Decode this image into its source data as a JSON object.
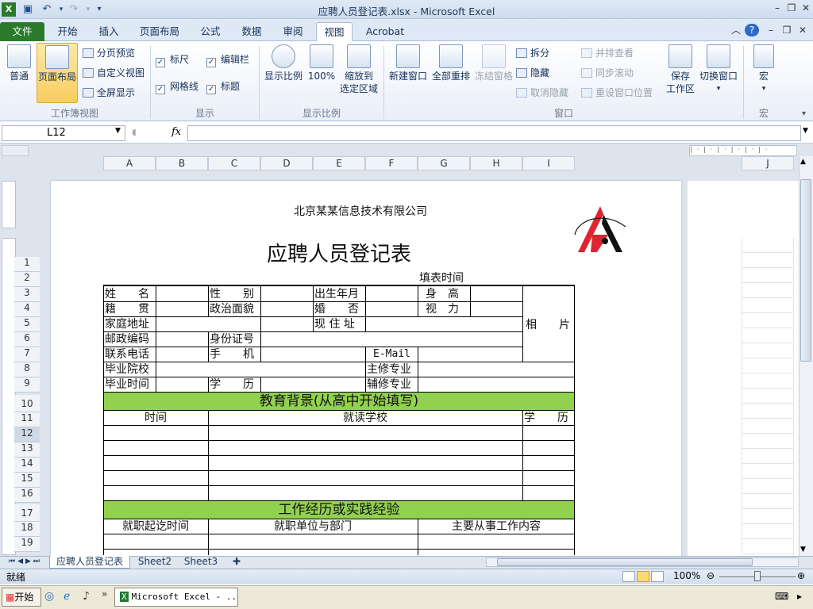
{
  "window": {
    "title": "应聘人员登记表.xlsx  -  Microsoft Excel"
  },
  "qat": {
    "save_icon": "save-icon",
    "undo_icon": "undo-icon",
    "redo_icon": "redo-icon"
  },
  "tabs": [
    {
      "label": "文件"
    },
    {
      "label": "开始"
    },
    {
      "label": "插入"
    },
    {
      "label": "页面布局"
    },
    {
      "label": "公式"
    },
    {
      "label": "数据"
    },
    {
      "label": "审阅"
    },
    {
      "label": "视图"
    },
    {
      "label": "Acrobat"
    }
  ],
  "ribbon": {
    "workbook_views": {
      "normal": "普通",
      "page_layout": "页面布局",
      "page_break": "分页预览",
      "custom_views": "自定义视图",
      "full_screen": "全屏显示",
      "group": "工作簿视图"
    },
    "show": {
      "ruler": "标尺",
      "formula_bar": "编辑栏",
      "gridlines": "网格线",
      "headings": "标题",
      "group": "显示"
    },
    "zoom": {
      "zoom": "显示比例",
      "zoom100": "100%",
      "zoom_sel_1": "缩放到",
      "zoom_sel_2": "选定区域",
      "group": "显示比例"
    },
    "window": {
      "new_window": "新建窗口",
      "arrange_all": "全部重排",
      "freeze": "冻结窗格",
      "split": "拆分",
      "hide": "隐藏",
      "unhide": "取消隐藏",
      "side_by_side": "并排查看",
      "sync_scroll": "同步滚动",
      "reset_pos": "重设窗口位置",
      "save_ws_1": "保存",
      "save_ws_2": "工作区",
      "switch": "切换窗口",
      "group": "窗口"
    },
    "macros": {
      "label": "宏",
      "group": "宏"
    }
  },
  "formula_bar": {
    "name_box": "L12",
    "fx": "fx",
    "value": ""
  },
  "columns": [
    "A",
    "B",
    "C",
    "D",
    "E",
    "F",
    "G",
    "H",
    "I",
    "J"
  ],
  "rows": [
    "1",
    "2",
    "3",
    "4",
    "5",
    "6",
    "7",
    "8",
    "9",
    "10",
    "11",
    "12",
    "13",
    "14",
    "15",
    "16",
    "17",
    "18",
    "19"
  ],
  "sheet": {
    "company": "北京某某信息技术有限公司",
    "title": "应聘人员登记表",
    "fill_time": "填表时间",
    "labels": {
      "name": "姓　　名",
      "gender": "性　　别",
      "birth": "出生年月",
      "height": "身　高",
      "origin": "籍　　贯",
      "politics": "政治面貌",
      "marriage": "婚　　否",
      "vision": "视　力",
      "address": "家庭地址",
      "current_addr": "现 住 址",
      "photo": "相　　片",
      "postcode": "邮政编码",
      "id": "身份证号",
      "phone": "联系电话",
      "mobile": "手　　机",
      "email": "E-Mail",
      "school": "毕业院校",
      "major": "主修专业",
      "grad_time": "毕业时间",
      "degree": "学　　历",
      "minor": "辅修专业"
    },
    "edu_header": "教育背景(从高中开始填写)",
    "edu_cols": {
      "time": "时间",
      "school": "就读学校",
      "degree": "学　　历"
    },
    "work_header": "工作经历或实践经验",
    "work_cols": {
      "period": "就职起讫时间",
      "unit": "就职单位与部门",
      "content": "主要从事工作内容"
    }
  },
  "sheet_tabs": [
    "应聘人员登记表",
    "Sheet2",
    "Sheet3"
  ],
  "status": {
    "ready": "就绪",
    "zoom": "100%"
  },
  "taskbar": {
    "start": "开始",
    "task": "Microsoft Excel - ..."
  },
  "colors": {
    "file_tab": "#2a7a2b",
    "section_fill": "#92d050"
  }
}
